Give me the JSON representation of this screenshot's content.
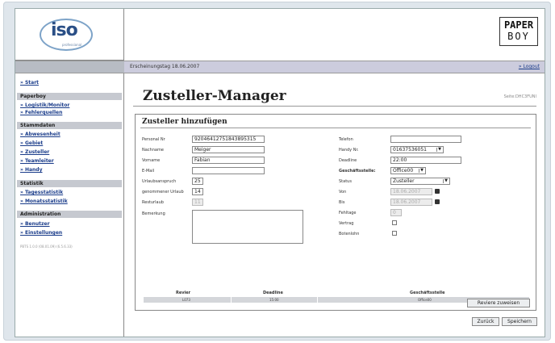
{
  "header": {
    "logo_text": "iso",
    "logo_sub": "professional",
    "brand_line1": "PAPER",
    "brand_line2": "BOY"
  },
  "topbar": {
    "date": "Erscheinungstag 18.06.2007",
    "logout": "» Logout"
  },
  "sidebar": {
    "start": "» Start",
    "sections": [
      {
        "title": "Paperboy",
        "items": [
          "» Logistik/Monitor",
          "» Fehlerquellen"
        ]
      },
      {
        "title": "Stammdaten",
        "items": [
          "» Abwesenheit",
          "» Gebiet",
          "» Zusteller",
          "» Teamleiter",
          "» Handy"
        ]
      },
      {
        "title": "Statistik",
        "items": [
          "» Tagesstatistik",
          "» Monatsstatistik"
        ]
      },
      {
        "title": "Administration",
        "items": [
          "» Benutzer",
          "» Einstellungen"
        ]
      }
    ],
    "version": "PBTS 1.0.0 (08.01.09) (6.5.6.33)"
  },
  "main": {
    "title": "Zusteller-Manager",
    "code": "Seite:DHC3FUNI",
    "form_title": "Zusteller hinzufügen",
    "left_fields": {
      "personalnr": {
        "label": "Personal Nr",
        "value": "92046412751843895315"
      },
      "nachname": {
        "label": "Nachname",
        "value": "Meiger"
      },
      "vorname": {
        "label": "Vorname",
        "value": "Fabian"
      },
      "email": {
        "label": "E-Mail",
        "value": ""
      },
      "urlaubsanspruch": {
        "label": "Urlaubsanspruch",
        "value": "25"
      },
      "genommener": {
        "label": "genommener Urlaub",
        "value": "14"
      },
      "resturlaub": {
        "label": "Resturlaub",
        "value": "11"
      },
      "bemerkung": {
        "label": "Bemerkung",
        "value": ""
      }
    },
    "right_fields": {
      "telefon": {
        "label": "Telefon",
        "value": ""
      },
      "handy": {
        "label": "Handy Nr.",
        "value": "01637536051"
      },
      "deadline": {
        "label": "Deadline",
        "value": "22:00"
      },
      "geschaeftsstelle": {
        "label": "Geschäftsstelle:",
        "value": "Office00"
      },
      "status": {
        "label": "Status",
        "value": "Zusteller"
      },
      "von": {
        "label": "Von",
        "value": "18.06.2007"
      },
      "bis": {
        "label": "Bis",
        "value": "18.06.2007"
      },
      "fehltage": {
        "label": "Fehltage",
        "value": "0"
      },
      "vertrag": {
        "label": "Vertrag"
      },
      "botenlohn": {
        "label": "Botenlohn"
      }
    },
    "table": {
      "headers": [
        "Revier",
        "Deadline",
        "Geschäftsstelle"
      ],
      "row": [
        "L073",
        "15:00",
        "Office00"
      ]
    },
    "buttons": {
      "revier": "Reviere zuweisen",
      "back": "Zurück",
      "save": "Speichern"
    }
  }
}
